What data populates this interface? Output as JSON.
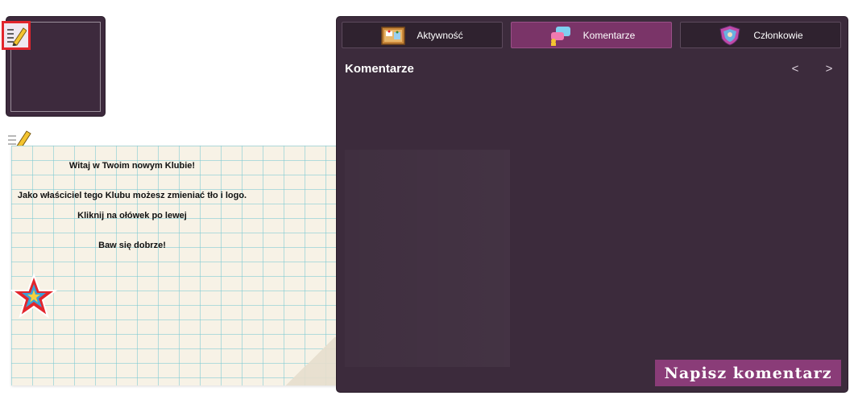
{
  "logo": {
    "edit_icon": "pencil-notepad-icon"
  },
  "paper": {
    "lines": [
      "Witaj w Twoim nowym Klubie!",
      "Jako właściciel tego Klubu możesz zmieniać tło i logo.",
      "Kliknij na ołówek po lewej",
      "Baw się dobrze!"
    ],
    "pencil_icon": "pencil-icon",
    "star_icon": "star-icon"
  },
  "tabs": [
    {
      "label": "Aktywność",
      "icon": "bulletin-board-icon",
      "active": false
    },
    {
      "label": "Komentarze",
      "icon": "chat-bubbles-icon",
      "active": true
    },
    {
      "label": "Członkowie",
      "icon": "shield-members-icon",
      "active": false
    }
  ],
  "main": {
    "title": "Komentarze",
    "prev": "<",
    "next": ">",
    "write_button": "Napisz komentarz"
  },
  "colors": {
    "panel": "#3c2b3c",
    "active_tab": "#7a3468",
    "button": "#8a3c78",
    "highlight": "#e2252c"
  }
}
